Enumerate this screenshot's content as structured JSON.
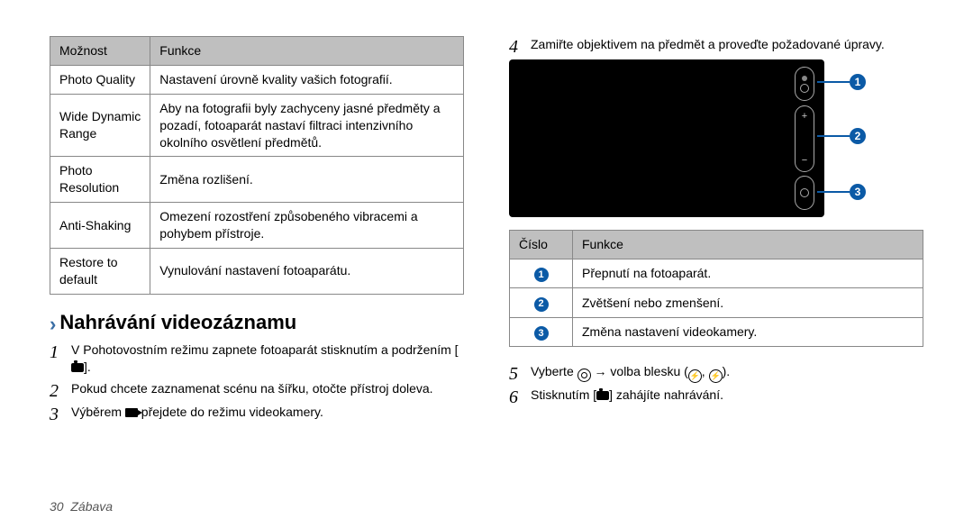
{
  "left_table": {
    "headers": [
      "Možnost",
      "Funkce"
    ],
    "rows": [
      {
        "opt": "Photo Quality",
        "fn": "Nastavení úrovně kvality vašich fotografií."
      },
      {
        "opt": "Wide Dynamic Range",
        "fn": "Aby na fotografii byly zachyceny jasné předměty a pozadí, fotoaparát nastaví filtraci intenzivního okolního osvětlení předmětů."
      },
      {
        "opt": "Photo Resolution",
        "fn": "Změna rozlišení."
      },
      {
        "opt": "Anti-Shaking",
        "fn": "Omezení rozostření způsobeného vibracemi a pohybem přístroje."
      },
      {
        "opt": "Restore to default",
        "fn": "Vynulování nastavení fotoaparátu."
      }
    ]
  },
  "heading": "Nahrávání videozáznamu",
  "left_steps": [
    {
      "n": "1",
      "text_a": "V Pohotovostním režimu zapnete fotoaparát stisknutím a podržením [",
      "text_b": "]."
    },
    {
      "n": "2",
      "text": "Pokud chcete zaznamenat scénu na šířku, otočte přístroj doleva."
    },
    {
      "n": "3",
      "text_a": "Výběrem ",
      "text_b": " přejdete do režimu videokamery."
    }
  ],
  "right_intro": {
    "n": "4",
    "text": "Zamiřte objektivem na předmět a proveďte požadované úpravy."
  },
  "right_table": {
    "headers": [
      "Číslo",
      "Funkce"
    ],
    "rows": [
      {
        "num": "1",
        "fn": "Přepnutí na fotoaparát."
      },
      {
        "num": "2",
        "fn": "Zvětšení nebo zmenšení."
      },
      {
        "num": "3",
        "fn": "Změna nastavení videokamery."
      }
    ]
  },
  "right_steps": [
    {
      "n": "5",
      "text_a": "Vyberte ",
      "text_b": " → volba blesku (",
      "text_c": ", ",
      "text_d": ")."
    },
    {
      "n": "6",
      "text_a": "Stisknutím [",
      "text_b": "] zahájíte nahrávání."
    }
  ],
  "callouts": [
    "1",
    "2",
    "3"
  ],
  "footer": {
    "page": "30",
    "section": "Zábava"
  }
}
